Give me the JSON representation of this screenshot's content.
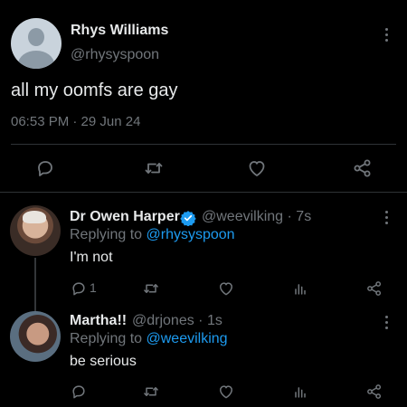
{
  "main_tweet": {
    "display_name": "Rhys Williams",
    "handle": "@rhysyspoon",
    "text": "all my oomfs are gay",
    "timestamp": "06:53 PM · 29 Jun 24",
    "actions": [
      "reply-icon",
      "retweet-icon",
      "like-icon",
      "share-icon"
    ]
  },
  "replies": [
    {
      "display_name": "Dr Owen Harper",
      "verified": true,
      "handle": "@weevilking",
      "time": "· 7s",
      "replying_prefix": "Replying to",
      "replying_to": "@rhysyspoon",
      "text": "I'm not",
      "reply_count": "1"
    },
    {
      "display_name": "Martha!!",
      "handle": "@drjones",
      "time": "· 1s",
      "replying_prefix": "Replying to",
      "replying_to": "@weevilking",
      "text": "be serious",
      "reply_count": ""
    }
  ],
  "colors": {
    "background": "#000000",
    "text": "#e7e9ea",
    "muted": "#71767b",
    "accent": "#1d9bf0",
    "divider": "#2f3336"
  }
}
